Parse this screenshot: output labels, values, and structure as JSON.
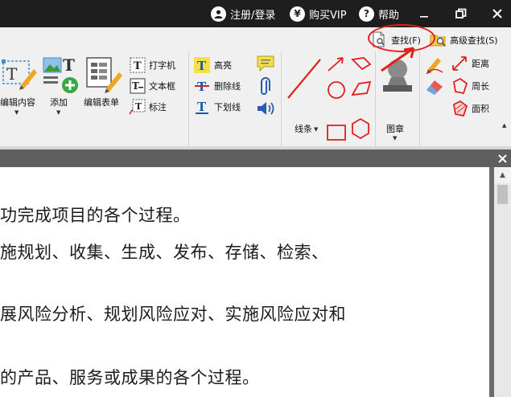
{
  "titlebar": {
    "login_label": "注册/登录",
    "vip_label": "购买VIP",
    "vip_icon": "¥",
    "help_label": "帮助",
    "help_icon": "?"
  },
  "ribbon": {
    "find_label": "查找(F)",
    "advanced_find_label": "高级查找(S)",
    "edit_content_label": "编辑内容",
    "add_label": "添加",
    "edit_form_label": "编辑表单",
    "typewriter_label": "打字机",
    "textbox_label": "文本框",
    "callout_label": "标注",
    "highlight_label": "高亮",
    "strikeout_label": "删除线",
    "underline_label": "下划线",
    "lines_label": "线条",
    "stamp_label": "图章",
    "distance_label": "距离",
    "perimeter_label": "周长",
    "area_label": "面积"
  },
  "document": {
    "lines": [
      "功完成项目的各个过程。",
      "施规划、收集、生成、发布、存储、检索、",
      "展风险分析、规划风险应对、实施风险应对和",
      "的产品、服务或成果的各个过程。"
    ]
  },
  "colors": {
    "titlebar_bg": "#1e1e1e",
    "ribbon_bg": "#f0f0f0",
    "annotation_red": "#e4201c"
  }
}
